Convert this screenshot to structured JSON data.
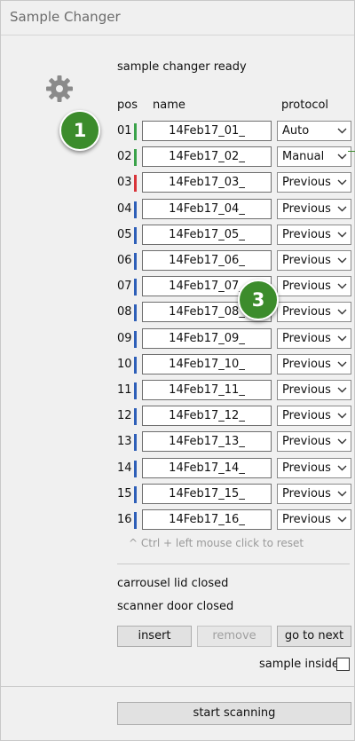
{
  "window": {
    "title": "Sample Changer"
  },
  "status": "sample changer ready",
  "columns": {
    "pos": "pos",
    "name": "name",
    "protocol": "protocol"
  },
  "colors": {
    "green": "#3aa24a",
    "red": "#d9343a",
    "blue": "#2e5fb8",
    "callout": "#3c8c2c"
  },
  "icons": {
    "status": "gear-icon",
    "dropdown": "chevron-down-icon"
  },
  "rows": [
    {
      "pos": "01",
      "name": "14Feb17_01_",
      "protocol": "Auto",
      "status_color": "green"
    },
    {
      "pos": "02",
      "name": "14Feb17_02_",
      "protocol": "Manual",
      "status_color": "green"
    },
    {
      "pos": "03",
      "name": "14Feb17_03_",
      "protocol": "Previous",
      "status_color": "red"
    },
    {
      "pos": "04",
      "name": "14Feb17_04_",
      "protocol": "Previous",
      "status_color": "blue"
    },
    {
      "pos": "05",
      "name": "14Feb17_05_",
      "protocol": "Previous",
      "status_color": "blue"
    },
    {
      "pos": "06",
      "name": "14Feb17_06_",
      "protocol": "Previous",
      "status_color": "blue"
    },
    {
      "pos": "07",
      "name": "14Feb17_07_",
      "protocol": "Previous",
      "status_color": "blue"
    },
    {
      "pos": "08",
      "name": "14Feb17_08_",
      "protocol": "Previous",
      "status_color": "blue"
    },
    {
      "pos": "09",
      "name": "14Feb17_09_",
      "protocol": "Previous",
      "status_color": "blue"
    },
    {
      "pos": "10",
      "name": "14Feb17_10_",
      "protocol": "Previous",
      "status_color": "blue"
    },
    {
      "pos": "11",
      "name": "14Feb17_11_",
      "protocol": "Previous",
      "status_color": "blue"
    },
    {
      "pos": "12",
      "name": "14Feb17_12_",
      "protocol": "Previous",
      "status_color": "blue"
    },
    {
      "pos": "13",
      "name": "14Feb17_13_",
      "protocol": "Previous",
      "status_color": "blue"
    },
    {
      "pos": "14",
      "name": "14Feb17_14_",
      "protocol": "Previous",
      "status_color": "blue"
    },
    {
      "pos": "15",
      "name": "14Feb17_15_",
      "protocol": "Previous",
      "status_color": "blue"
    },
    {
      "pos": "16",
      "name": "14Feb17_16_",
      "protocol": "Previous",
      "status_color": "blue"
    }
  ],
  "hint": "^ Ctrl + left mouse click to reset",
  "lid_status": "carrousel lid closed",
  "door_status": "scanner door closed",
  "buttons": {
    "insert": "insert",
    "remove": "remove",
    "go_to_next": "go to next",
    "start_scanning": "start scanning"
  },
  "sample_inside": {
    "label": "sample inside",
    "checked": false
  },
  "callouts": [
    "1",
    "3"
  ]
}
